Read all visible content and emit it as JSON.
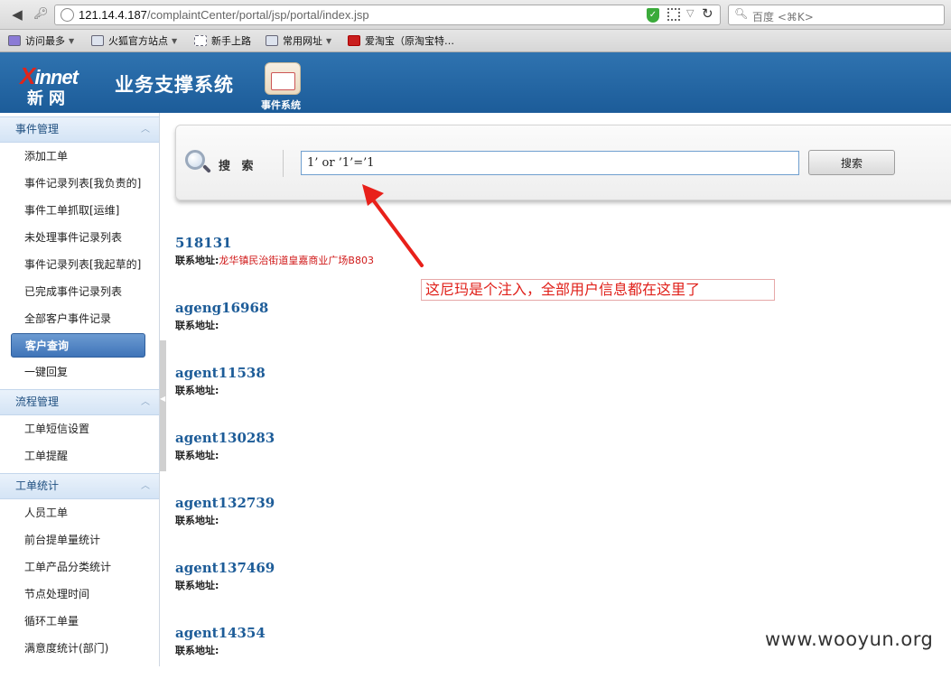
{
  "browser": {
    "url_host": "121.14.4.187",
    "url_path": "/complaintCenter/portal/jsp/portal/index.jsp",
    "search_placeholder": "百度 <⌘K>",
    "bookmarks": [
      {
        "label": "访问最多",
        "icon": "purple-folder-icon",
        "has_dropdown": true
      },
      {
        "label": "火狐官方站点",
        "icon": "folder-icon",
        "has_dropdown": true
      },
      {
        "label": "新手上路",
        "icon": "page-icon",
        "has_dropdown": false
      },
      {
        "label": "常用网址",
        "icon": "folder-icon",
        "has_dropdown": true
      },
      {
        "label": "爱淘宝（原淘宝特…",
        "icon": "taobao-icon",
        "has_dropdown": false
      }
    ]
  },
  "header": {
    "logo_text": "innet",
    "logo_x": "X",
    "logo_cn": "新网",
    "system_title": "业务支撑系统",
    "module_label": "事件系统"
  },
  "sidebar": {
    "sections": [
      {
        "title": "事件管理",
        "items": [
          {
            "label": "添加工单"
          },
          {
            "label": "事件记录列表[我负责的]"
          },
          {
            "label": "事件工单抓取[运维]"
          },
          {
            "label": "未处理事件记录列表"
          },
          {
            "label": "事件记录列表[我起草的]"
          },
          {
            "label": "已完成事件记录列表"
          },
          {
            "label": "全部客户事件记录"
          },
          {
            "label": "客户查询"
          },
          {
            "label": "一键回复"
          }
        ]
      },
      {
        "title": "流程管理",
        "items": [
          {
            "label": "工单短信设置"
          },
          {
            "label": "工单提醒"
          }
        ]
      },
      {
        "title": "工单统计",
        "items": [
          {
            "label": "人员工单"
          },
          {
            "label": "前台提单量统计"
          },
          {
            "label": "工单产品分类统计"
          },
          {
            "label": "节点处理时间"
          },
          {
            "label": "循环工单量"
          },
          {
            "label": "满意度统计(部门)"
          }
        ]
      }
    ],
    "active_item": "客户查询"
  },
  "search": {
    "label": "搜 索",
    "query": "1’ or ’1’=’1",
    "button_label": "搜索"
  },
  "results": [
    {
      "name": "518131",
      "addr_label": "联系地址:",
      "addr_value": "龙华镇民治街道皇嘉商业广场B803"
    },
    {
      "name": "ageng16968",
      "addr_label": "联系地址:",
      "addr_value": ""
    },
    {
      "name": "agent11538",
      "addr_label": "联系地址:",
      "addr_value": ""
    },
    {
      "name": "agent130283",
      "addr_label": "联系地址:",
      "addr_value": ""
    },
    {
      "name": "agent132739",
      "addr_label": "联系地址:",
      "addr_value": ""
    },
    {
      "name": "agent137469",
      "addr_label": "联系地址:",
      "addr_value": ""
    },
    {
      "name": "agent14354",
      "addr_label": "联系地址:",
      "addr_value": ""
    }
  ],
  "annotation": {
    "text": "这尼玛是个注入，全部用户信息都在这里了",
    "color": "#e0201a"
  },
  "watermark": "www.wooyun.org",
  "colors": {
    "header_blue": "#1c5c99",
    "link_blue": "#1d5c98",
    "active_item": "#3f74b8",
    "address_red": "#d01919"
  }
}
